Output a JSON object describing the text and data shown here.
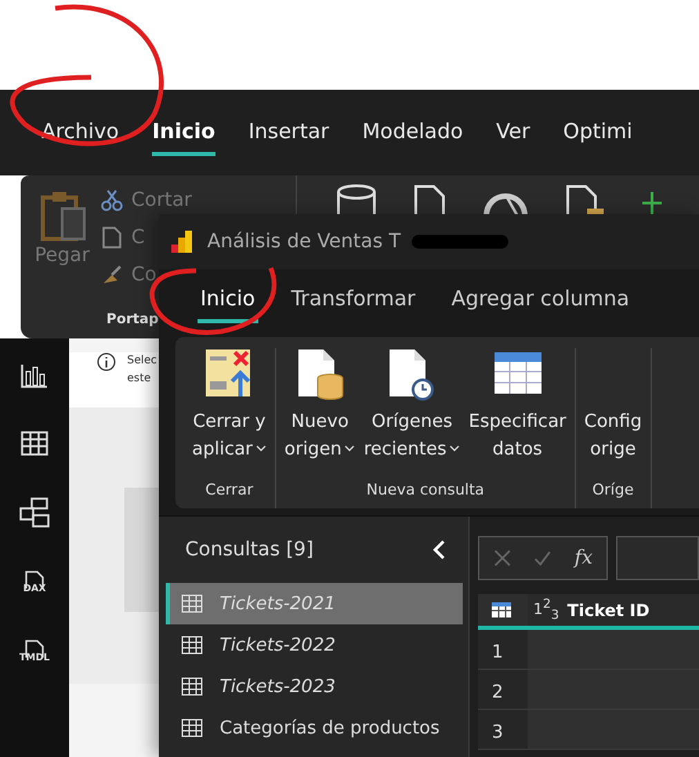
{
  "background_window": {
    "menu_tabs": [
      {
        "label": "Archivo",
        "selected": false
      },
      {
        "label": "Inicio",
        "selected": true
      },
      {
        "label": "Insertar",
        "selected": false
      },
      {
        "label": "Modelado",
        "selected": false
      },
      {
        "label": "Ver",
        "selected": false
      },
      {
        "label": "Optimi",
        "selected": false
      }
    ],
    "clipboard": {
      "paste": "Pegar",
      "cut": "Cortar",
      "copy": "C",
      "format": "Co",
      "group": "Portap"
    },
    "nav": [
      {
        "kind": "report"
      },
      {
        "kind": "table"
      },
      {
        "kind": "model"
      },
      {
        "kind": "dax",
        "label": "DAX"
      },
      {
        "kind": "tmdl",
        "label": "TMDL"
      }
    ],
    "info_text": [
      "Selec",
      "este"
    ]
  },
  "query_editor": {
    "title": "Análisis de Ventas T",
    "title_redacted": true,
    "tabs": [
      {
        "label": "Inicio",
        "selected": true
      },
      {
        "label": "Transformar",
        "selected": false
      },
      {
        "label": "Agregar columna",
        "selected": false
      }
    ],
    "ribbon_groups": [
      {
        "label": "Cerrar",
        "buttons": [
          {
            "kind": "close-apply",
            "lines": [
              "Cerrar y",
              "aplicar"
            ],
            "dropdown": true
          }
        ]
      },
      {
        "label": "Nueva consulta",
        "buttons": [
          {
            "kind": "new-source",
            "lines": [
              "Nuevo",
              "origen"
            ],
            "dropdown": true
          },
          {
            "kind": "recent",
            "lines": [
              "Orígenes",
              "recientes"
            ],
            "dropdown": true
          },
          {
            "kind": "enter-data",
            "lines": [
              "Especificar",
              "datos"
            ],
            "dropdown": false
          }
        ]
      },
      {
        "label": "Oríge",
        "buttons": [
          {
            "kind": "settings",
            "lines": [
              "Config",
              "orige"
            ],
            "dropdown": false
          }
        ]
      }
    ],
    "queries_title": "Consultas [9]",
    "queries": [
      {
        "label": "Tickets-2021",
        "selected": true,
        "italic": true
      },
      {
        "label": "Tickets-2022",
        "selected": false,
        "italic": true
      },
      {
        "label": "Tickets-2023",
        "selected": false,
        "italic": true
      },
      {
        "label": "Categorías de productos",
        "selected": false,
        "italic": false
      }
    ],
    "formula_fx": "fx",
    "columns": [
      {
        "type": "1$^{2}$$_{3}$",
        "label": "Ticket ID"
      }
    ],
    "row_numbers": [
      "1",
      "2",
      "3"
    ]
  },
  "markup": [
    {
      "kind": "circle"
    },
    {
      "kind": "circle"
    }
  ]
}
